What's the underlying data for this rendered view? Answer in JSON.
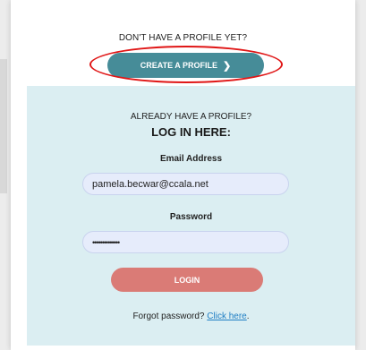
{
  "signup": {
    "prompt": "DON'T HAVE A PROFILE YET?",
    "button_label": "CREATE A PROFILE",
    "button_icon": "chevron-right-icon"
  },
  "login": {
    "prompt": "ALREADY HAVE A PROFILE?",
    "title": "LOG IN HERE:",
    "email_label": "Email Address",
    "email_value": "pamela.becwar@ccala.net",
    "password_label": "Password",
    "password_value": "••••••••••••••",
    "button_label": "LOGIN",
    "forgot_text": "Forgot password?",
    "forgot_link": "Click here",
    "forgot_end": "."
  },
  "colors": {
    "create_button": "#468c98",
    "login_button": "#da7b76",
    "login_panel": "#dbeef2",
    "highlight": "#e01616"
  }
}
